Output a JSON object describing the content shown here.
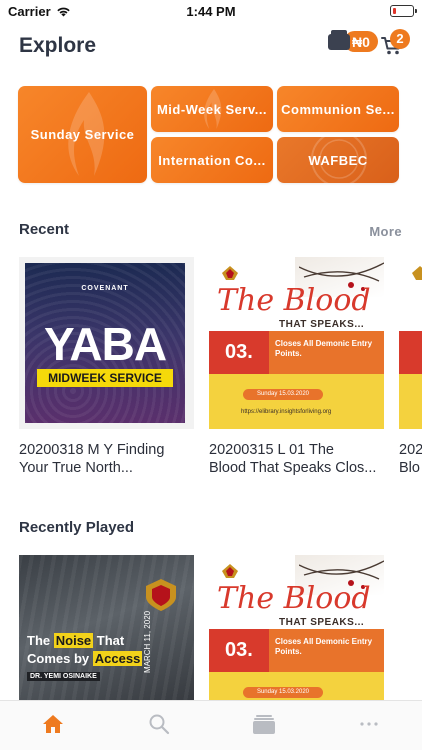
{
  "status_bar": {
    "carrier": "Carrier",
    "time": "1:44 PM"
  },
  "header": {
    "title": "Explore",
    "wallet_balance": "₦0",
    "cart_count": "2"
  },
  "categories": [
    {
      "label": "Sunday Service"
    },
    {
      "label": "Mid-Week Serv..."
    },
    {
      "label": "Communion Se..."
    },
    {
      "label": "Internation Co..."
    },
    {
      "label": "WAFBEC"
    }
  ],
  "recent": {
    "title": "Recent",
    "more_label": "More",
    "items": [
      {
        "title_line1": "20200318 M Y Finding",
        "title_line2": "Your True North...",
        "thumb_text_main": "YABA",
        "thumb_text_sub": "MIDWEEK SERVICE",
        "thumb_text_top": "COVENANT"
      },
      {
        "title_line1": "20200315 L 01 The",
        "title_line2": "Blood That Speaks Clos...",
        "thumb_script": "The Blood",
        "thumb_caps": "THAT SPEAKS...",
        "thumb_number": "03.",
        "thumb_point": "Closes All Demonic Entry Points.",
        "thumb_date": "Sunday 15.03.2020",
        "thumb_url": "https://elibrary.insightsforliving.org"
      },
      {
        "title_line1": "202",
        "title_line2": "Blo"
      }
    ]
  },
  "recently_played": {
    "title": "Recently Played",
    "items": [
      {
        "thumb_line1a": "The",
        "thumb_noise": "Noise",
        "thumb_line1b": "That",
        "thumb_line2a": "Comes by",
        "thumb_access": "Access",
        "thumb_speaker": "DR. YEMI OSINAIKE",
        "thumb_date": "MARCH 11, 2020"
      },
      {
        "thumb_script": "The Blood",
        "thumb_caps": "THAT SPEAKS...",
        "thumb_number": "03.",
        "thumb_point": "Closes All Demonic Entry Points.",
        "thumb_date": "Sunday 15.03.2020"
      }
    ]
  },
  "tabs": [
    {
      "name": "home",
      "active": true
    },
    {
      "name": "search",
      "active": false
    },
    {
      "name": "library",
      "active": false
    },
    {
      "name": "more",
      "active": false
    }
  ],
  "colors": {
    "accent": "#ee7a1f",
    "text": "#2e3544",
    "muted": "#8a909c"
  }
}
